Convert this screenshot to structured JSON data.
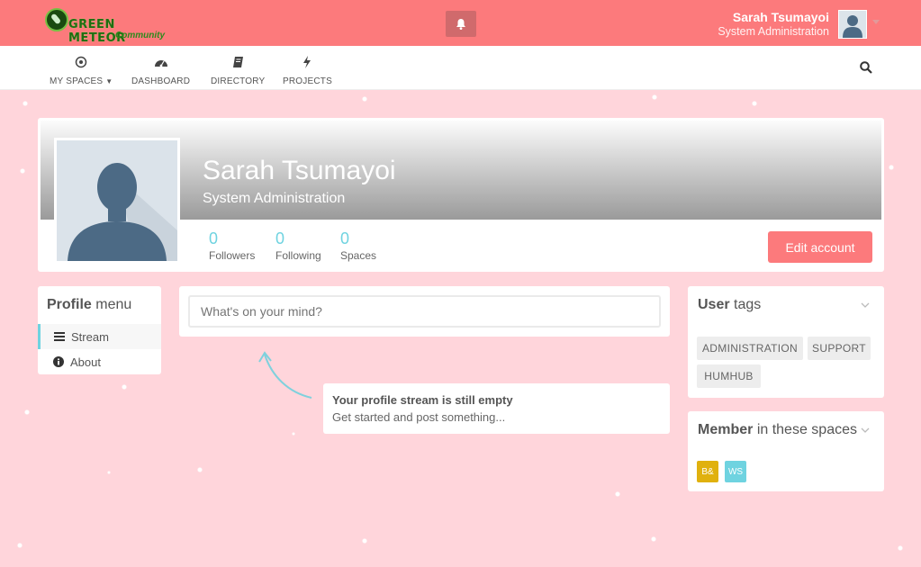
{
  "brand": {
    "logo_text": "GREEN METEOR",
    "logo_sub": "Community"
  },
  "header": {
    "user_name": "Sarah Tsumayoi",
    "user_role": "System Administration"
  },
  "nav": {
    "items": [
      {
        "label": "MY SPACES",
        "icon": "target-icon"
      },
      {
        "label": "DASHBOARD",
        "icon": "dashboard-icon"
      },
      {
        "label": "DIRECTORY",
        "icon": "book-icon"
      },
      {
        "label": "PROJECTS",
        "icon": "bolt-icon"
      }
    ]
  },
  "profile": {
    "name": "Sarah Tsumayoi",
    "title": "System Administration",
    "stats": [
      {
        "value": "0",
        "label": "Followers"
      },
      {
        "value": "0",
        "label": "Following"
      },
      {
        "value": "0",
        "label": "Spaces"
      }
    ],
    "edit_label": "Edit account"
  },
  "profile_menu": {
    "title_bold": "Profile",
    "title_rest": "menu",
    "items": [
      {
        "label": "Stream",
        "icon": "bars-icon",
        "active": true
      },
      {
        "label": "About",
        "icon": "info-icon",
        "active": false
      }
    ]
  },
  "stream": {
    "placeholder": "What's on your mind?",
    "empty_title": "Your profile stream is still empty",
    "empty_sub": "Get started and post something..."
  },
  "user_tags": {
    "title_bold": "User",
    "title_rest": "tags",
    "tags": [
      "ADMINISTRATION",
      "SUPPORT",
      "HUMHUB"
    ]
  },
  "member_spaces": {
    "title_bold": "Member",
    "title_rest": "in these spaces",
    "spaces": [
      {
        "abbr": "B&",
        "color": "#e0b10e"
      },
      {
        "abbr": "WS",
        "color": "#6fd3e0"
      }
    ]
  },
  "colors": {
    "accent": "#fc7a7c",
    "info": "#6fd3e0",
    "background": "#ffd5db"
  }
}
